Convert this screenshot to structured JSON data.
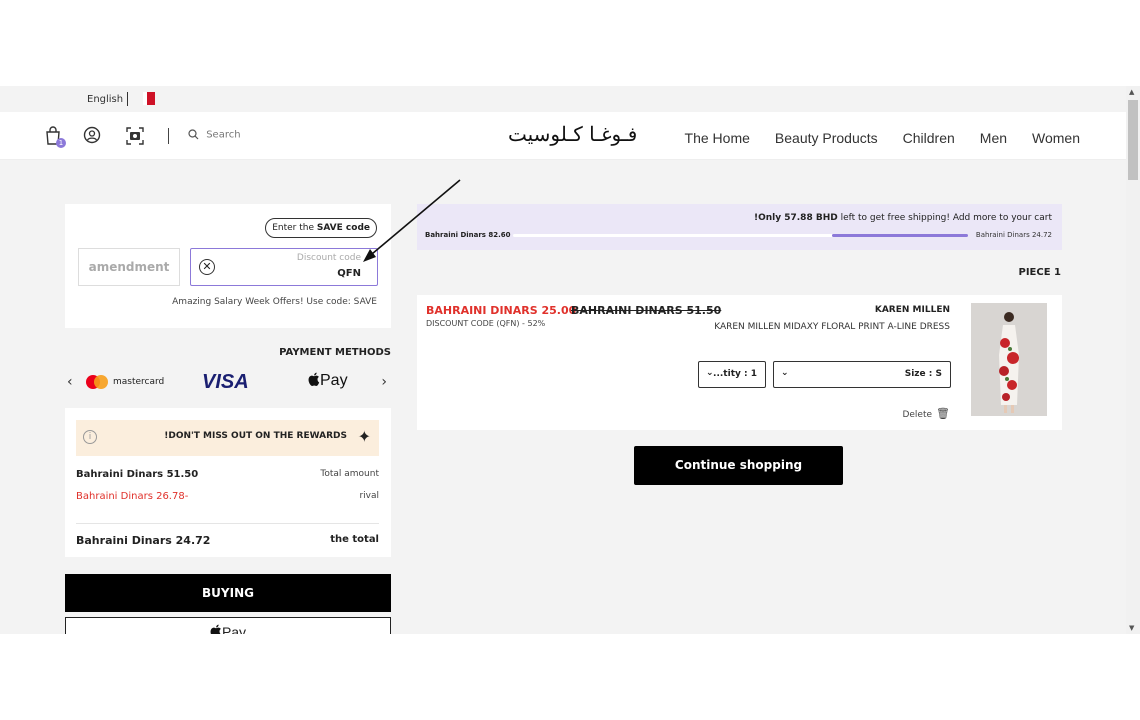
{
  "topbar": {
    "language": "English"
  },
  "header": {
    "cart_count": "1",
    "search_placeholder": "Search",
    "logo": "فـوغـا كـلوسيت",
    "nav": [
      "The Home",
      "Beauty Products",
      "Children",
      "Men",
      "Women"
    ]
  },
  "coupon": {
    "pill_prefix": "Enter the ",
    "pill_bold": "SAVE code",
    "amend_label": "amendment",
    "discount_placeholder": "Discount code",
    "discount_value": "QFN",
    "offer_note": "Amazing Salary Week Offers! Use code: SAVE"
  },
  "payment": {
    "title": "PAYMENT METHODS",
    "mastercard_label": "mastercard",
    "visa_label": "VISA",
    "applepay_label": "Pay",
    "icons": [
      "chevron-left-icon",
      "mastercard-icon",
      "visa-icon",
      "apple-pay-icon",
      "chevron-right-icon"
    ]
  },
  "summary": {
    "rewards": "!DON'T MISS OUT ON THE REWARDS",
    "total_amount_label": "Total amount",
    "total_amount_value": "Bahraini Dinars 51.50",
    "rival_label": "rival",
    "rival_value": "Bahraini Dinars 26.78-",
    "total_label": "the total",
    "total_value": "Bahraini Dinars 24.72"
  },
  "actions": {
    "buy": "BUYING",
    "apple_pay": "Pay",
    "continue": "Continue shopping"
  },
  "shipping": {
    "msg_bold": "!Only 57.88 BHD",
    "msg_rest": " left to get free shipping! Add more to your cart",
    "left_label": "Bahraini Dinars 82.60",
    "right_label": "Bahraini Dinars 24.72",
    "progress": 0.3
  },
  "cart": {
    "piece_label": "PIECE 1",
    "item": {
      "price_now": "BAHRAINI DINARS 25.00",
      "price_old": "BAHRAINI DINARS 51.50",
      "discount_note": "DISCOUNT CODE (QFN) - 52%",
      "brand": "KAREN MILLEN",
      "name": "KAREN MILLEN MIDAXY FLORAL PRINT A-LINE DRESS",
      "quantity_label": "...tity : 1",
      "size_label": "Size : S",
      "delete_label": "Delete"
    }
  },
  "colors": {
    "accent": "#8c79d9",
    "sale": "#e0312b",
    "rewards_bg": "#fbeedd",
    "shipping_bg": "#ebe7f7"
  }
}
